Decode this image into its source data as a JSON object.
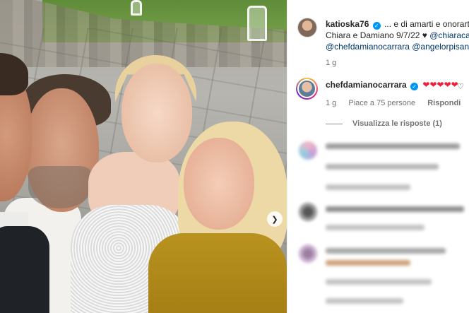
{
  "post": {
    "author": "katioska76",
    "caption_line1": "... e di amarti e onorarti tut",
    "caption_line2_text": "Chiara e Damiano 9/7/22 ♥ ",
    "caption_line2_mention": "@chiaracandy",
    "caption_line3_mention1": "@chefdamianocarrara",
    "caption_line3_mention2": "@angelorpisani",
    "time_ago": "1 g"
  },
  "comment": {
    "author": "chefdamianocarrara",
    "verified_mark": "✓",
    "hearts": "❤❤❤❤❤",
    "time_ago": "1 g",
    "likes": "Piace a 75 persone",
    "reply_label": "Rispondi",
    "view_replies": "Visualizza le risposte (1)"
  },
  "icons": {
    "photo_next": "chevron-right-icon",
    "comment_like": "heart-outline-icon"
  },
  "colors": {
    "mention": "#00376b",
    "verified": "#0095f6",
    "heart": "#ed1f3a",
    "meta_text": "#737373"
  }
}
